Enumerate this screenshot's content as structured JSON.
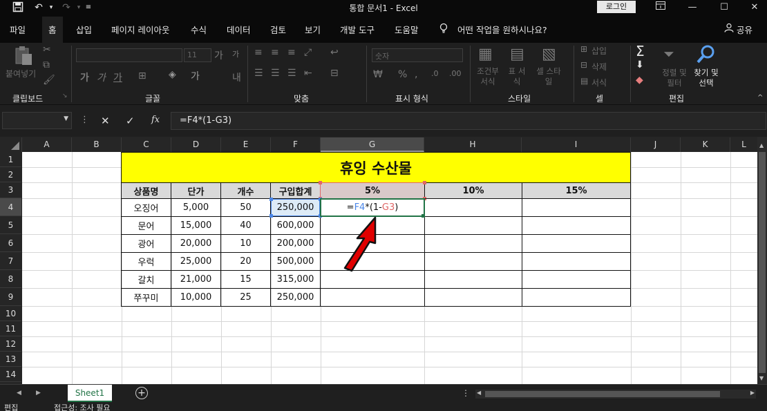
{
  "window": {
    "title": "통합 문서1  -  Excel",
    "login_label": "로그인",
    "quick_access": {
      "save_icon": "save-icon",
      "undo_icon": "undo-icon",
      "redo_icon": "redo-icon",
      "customize_icon": "customize-icon"
    }
  },
  "menu": {
    "items": [
      "파일",
      "홈",
      "삽입",
      "페이지 레이아웃",
      "수식",
      "데이터",
      "검토",
      "보기",
      "개발 도구",
      "도움말"
    ],
    "active": "홈",
    "tell_me": "어떤 작업을 원하시나요?",
    "share": "공유"
  },
  "ribbon": {
    "clipboard": {
      "label": "클립보드",
      "paste": "붙여넣기"
    },
    "font": {
      "label": "글꼴",
      "size": "11",
      "bold": "가",
      "italic": "가",
      "underline": "가"
    },
    "alignment": {
      "label": "맞춤"
    },
    "number": {
      "label": "표시 형식",
      "format": "숫자"
    },
    "styles": {
      "label": "스타일",
      "conditional": "조건부 서식",
      "table": "표 서식",
      "cell": "셀 스타일"
    },
    "cells": {
      "label": "셀",
      "insert": "삽입",
      "delete": "삭제",
      "format": "서식"
    },
    "editing": {
      "label": "편집",
      "sort": "정렬 및 필터",
      "find": "찾기 및 선택"
    }
  },
  "formula_bar": {
    "formula": "=F4*(1-G3)"
  },
  "grid": {
    "columns": [
      "A",
      "B",
      "C",
      "D",
      "E",
      "F",
      "G",
      "H",
      "I",
      "J",
      "K",
      "L"
    ],
    "rows": [
      "1",
      "2",
      "3",
      "4",
      "5",
      "6",
      "7",
      "8",
      "9",
      "10",
      "11",
      "12",
      "13",
      "14"
    ],
    "selected_column": "G",
    "selected_row": "4",
    "title": "휴잉 수산물",
    "headers": [
      "상품명",
      "단가",
      "개수",
      "구입합계",
      "5%",
      "10%",
      "15%"
    ],
    "data": [
      [
        "오징어",
        "5,000",
        "50",
        "250,000"
      ],
      [
        "문어",
        "15,000",
        "40",
        "600,000"
      ],
      [
        "광어",
        "20,000",
        "10",
        "200,000"
      ],
      [
        "우럭",
        "25,000",
        "20",
        "500,000"
      ],
      [
        "갈치",
        "21,000",
        "15",
        "315,000"
      ],
      [
        "쭈꾸미",
        "10,000",
        "25",
        "250,000"
      ]
    ],
    "editing_cell": {
      "prefix": "=",
      "ref1": "F4",
      "mid": "*(1-",
      "ref2": "G3",
      "suffix": ")"
    }
  },
  "sheets": {
    "active": "Sheet1"
  },
  "status": {
    "mode": "편집",
    "accessibility": "접근성: 조사 필요"
  },
  "colors": {
    "title_fill": "#ffff00",
    "header_fill": "#d9d9d9",
    "ref1": "#4a86e8",
    "ref2": "#e06666",
    "selection": "#217346",
    "arrow": "#e00000"
  }
}
